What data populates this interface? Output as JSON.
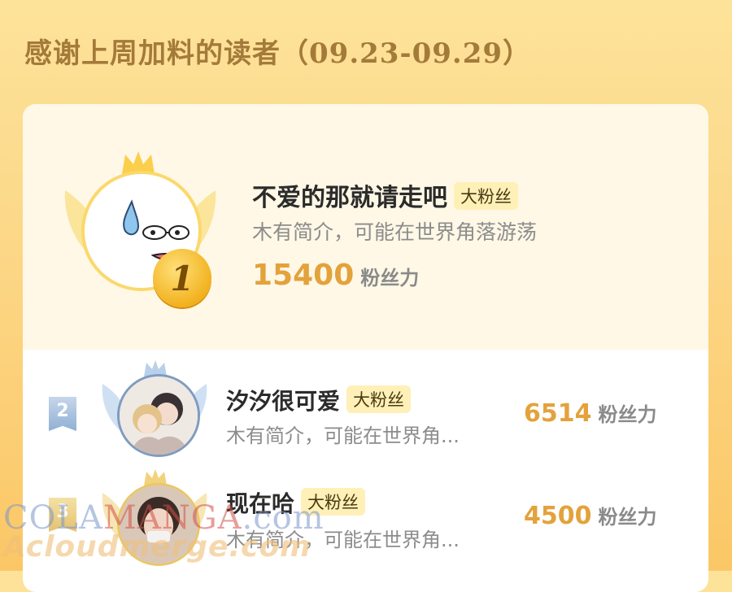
{
  "header": {
    "title": "感谢上周加料的读者",
    "date_range": "（09.23-09.29）"
  },
  "ranking": [
    {
      "rank": "1",
      "name": "不爱的那就请走吧",
      "badge": "大粉丝",
      "bio": "木有简介，可能在世界角落游荡",
      "score": "15400",
      "unit": "粉丝力"
    },
    {
      "rank": "2",
      "name": "汐汐很可爱",
      "badge": "大粉丝",
      "bio": "木有简介，可能在世界角...",
      "score": "6514",
      "unit": "粉丝力"
    },
    {
      "rank": "3",
      "name": "现在哈",
      "badge": "大粉丝",
      "bio": "木有简介，可能在世界角...",
      "score": "4500",
      "unit": "粉丝力"
    }
  ],
  "watermark": {
    "line1_a": "COLA",
    "line1_b": "MANGA",
    "line1_c": ".com",
    "line2": "Acloudmerge.com"
  },
  "colors": {
    "accent": "#e3a23b",
    "title": "#a47a3a",
    "badge_bg": "#fff0b8"
  }
}
